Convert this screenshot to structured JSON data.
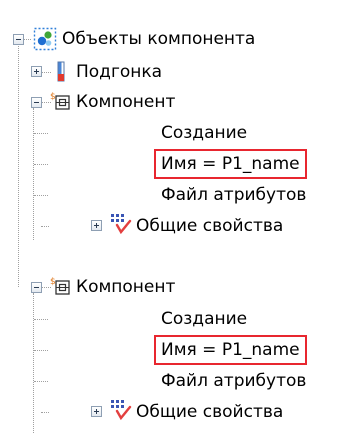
{
  "tree": {
    "root": {
      "label": "Объекты компонента",
      "icon": "component-objects-icon",
      "expanded": true
    },
    "nodes": [
      {
        "id": "fit",
        "label": "Подгонка",
        "icon": "fitting-icon",
        "level": 1,
        "expander": "plus"
      },
      {
        "id": "comp1",
        "label": "Компонент",
        "icon": "component-icon",
        "level": 1,
        "expander": "minus"
      },
      {
        "id": "comp1-create",
        "label": "Создание",
        "level": 2
      },
      {
        "id": "comp1-name",
        "label": "Имя = P1_name",
        "level": 2,
        "highlighted": true
      },
      {
        "id": "comp1-attrfile",
        "label": "Файл атрибутов",
        "level": 2
      },
      {
        "id": "comp1-props",
        "label": "Общие свойства",
        "icon": "properties-icon",
        "level": 2,
        "expander": "plus"
      },
      {
        "id": "comp2",
        "label": "Компонент",
        "icon": "component-icon",
        "level": 1,
        "expander": "minus"
      },
      {
        "id": "comp2-create",
        "label": "Создание",
        "level": 2
      },
      {
        "id": "comp2-name",
        "label": "Имя = P1_name",
        "level": 2,
        "highlighted": true
      },
      {
        "id": "comp2-attrfile",
        "label": "Файл атрибутов",
        "level": 2
      },
      {
        "id": "comp2-props",
        "label": "Общие свойства",
        "icon": "properties-icon",
        "level": 2,
        "expander": "plus"
      }
    ]
  },
  "colors": {
    "highlight_border": "#e8262f",
    "connector": "#a0a0a0",
    "expander_border": "#8e9fb3"
  }
}
